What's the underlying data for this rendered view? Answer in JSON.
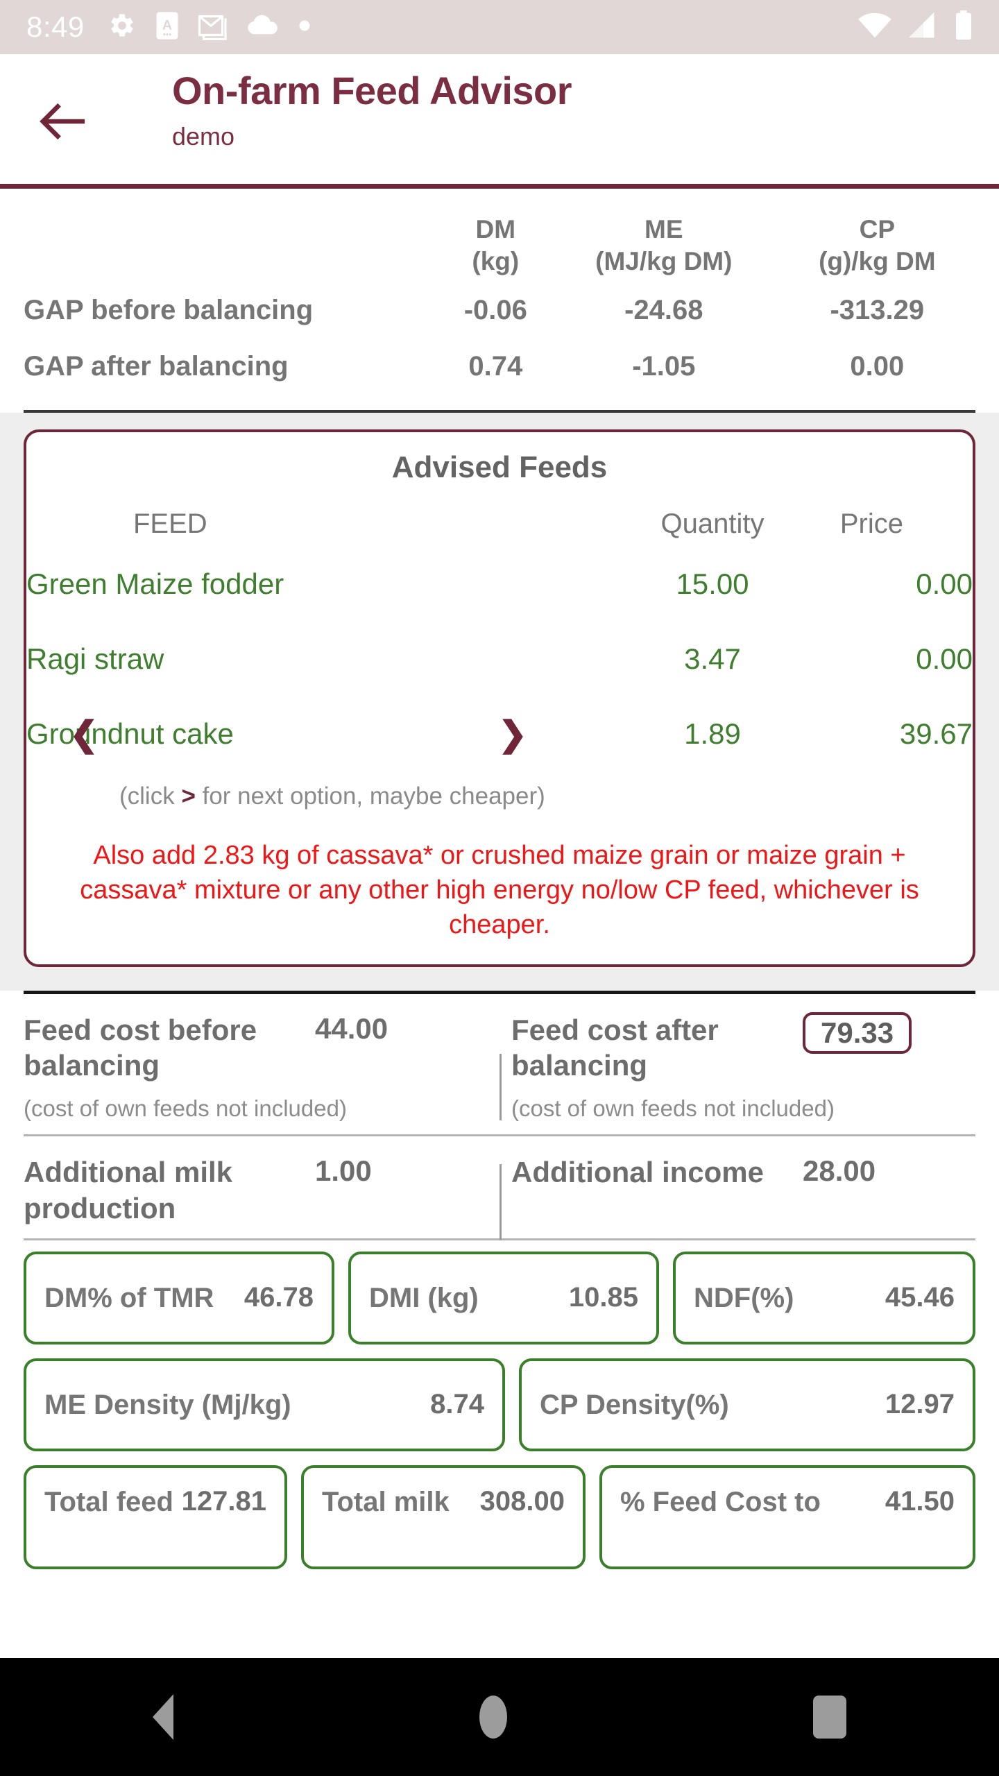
{
  "status_bar": {
    "time": "8:49",
    "left_icons": [
      "gear-icon",
      "a-card-icon",
      "gmail-icon",
      "cloud-icon",
      "dot-icon"
    ],
    "right_icons": [
      "wifi-icon",
      "signal-icon",
      "battery-icon"
    ],
    "background": "#e2d7d7"
  },
  "header": {
    "back_label": "←",
    "title": "On-farm Feed Advisor",
    "subtitle": "demo",
    "accent": "#7b2e42"
  },
  "gap_table": {
    "columns": [
      {
        "name": "DM",
        "unit": "(kg)"
      },
      {
        "name": "ME",
        "unit": "(MJ/kg DM)"
      },
      {
        "name": "CP",
        "unit": "(g)/kg DM"
      }
    ],
    "rows": [
      {
        "label": "GAP before balancing",
        "dm": "-0.06",
        "me": "-24.68",
        "cp": "-313.29"
      },
      {
        "label": "GAP after balancing",
        "dm": "0.74",
        "me": "-1.05",
        "cp": "0.00"
      }
    ]
  },
  "advised_feeds": {
    "title": "Advised Feeds",
    "headers": {
      "feed": "FEED",
      "quantity": "Quantity",
      "price": "Price"
    },
    "rows": [
      {
        "name": "Green Maize fodder",
        "quantity": "15.00",
        "price": "0.00",
        "has_arrows": false
      },
      {
        "name": "Ragi straw",
        "quantity": "3.47",
        "price": "0.00",
        "has_arrows": false
      },
      {
        "name": "Groundnut cake",
        "quantity": "1.89",
        "price": "39.67",
        "has_arrows": true
      }
    ],
    "prev_icon": "❮",
    "next_icon": "❯",
    "hint_prefix": "(click ",
    "hint_symbol": ">",
    "hint_suffix": " for next option, maybe cheaper)",
    "warning": "Also add 2.83 kg of cassava* or crushed maize grain or maize grain + cassava* mixture or any other high energy no/low CP feed, whichever is cheaper.",
    "warning_color": "#f01616",
    "border_color": "#6f2639",
    "feed_text_color": "#3f7e2e"
  },
  "cost_section": {
    "before": {
      "label": "Feed cost before balancing",
      "value": "44.00",
      "note": "(cost of own feeds not included)"
    },
    "after": {
      "label": "Feed cost after balancing",
      "value": "79.33",
      "note": "(cost of own feeds not included)"
    },
    "milk": {
      "label": "Additional milk production",
      "value": "1.00"
    },
    "income": {
      "label": "Additional income",
      "value": "28.00"
    }
  },
  "metrics": {
    "row1": [
      {
        "label": "DM% of TMR",
        "value": "46.78"
      },
      {
        "label": "DMI (kg)",
        "value": "10.85"
      },
      {
        "label": "NDF(%)",
        "value": "45.46"
      }
    ],
    "row2": [
      {
        "label": "ME Density (Mj/kg)",
        "value": "8.74"
      },
      {
        "label": "CP Density(%)",
        "value": "12.97"
      }
    ],
    "row3": [
      {
        "label": "Total feed",
        "value": "127.81"
      },
      {
        "label": "Total milk",
        "value": "308.00"
      },
      {
        "label": "% Feed Cost to",
        "value": "41.50"
      }
    ],
    "border_color": "#3c7f2a"
  },
  "navigation_bar": {
    "back": "back-triangle-icon",
    "home": "home-circle-icon",
    "recents": "recents-square-icon"
  }
}
